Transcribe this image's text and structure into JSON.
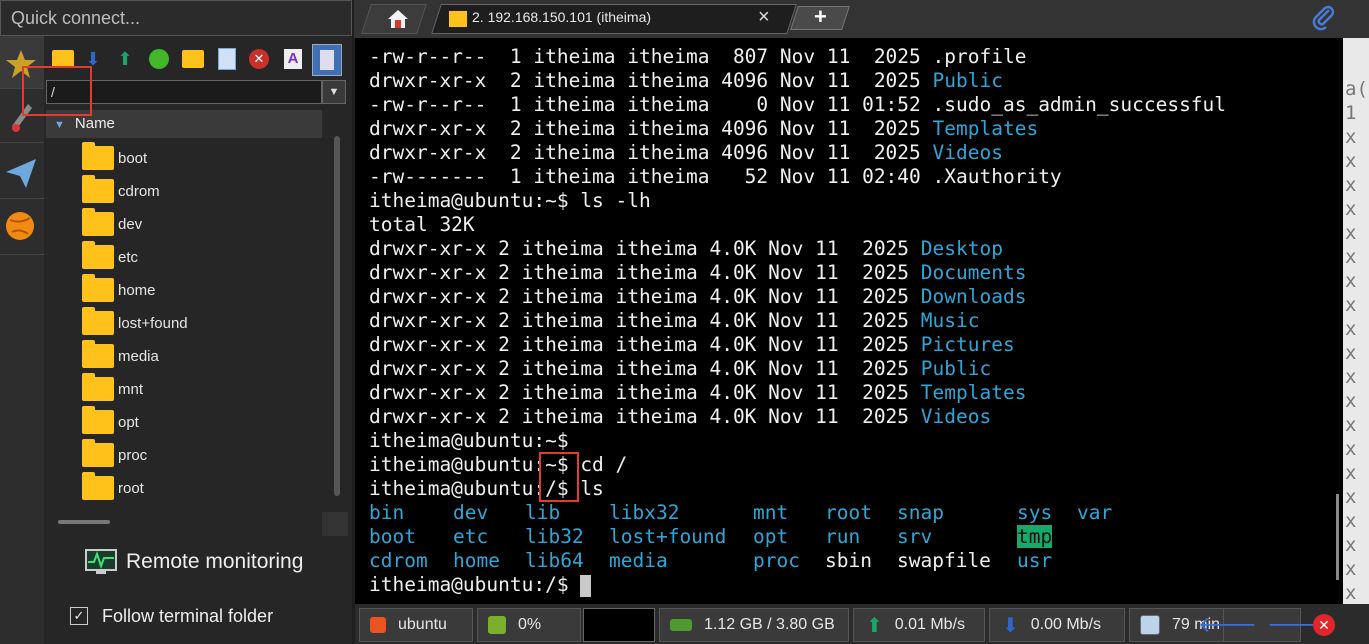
{
  "quick_connect": {
    "placeholder": "Quick connect..."
  },
  "tabs": [
    {
      "label": "2. 192.168.150.101 (itheima)",
      "close": "×"
    }
  ],
  "new_tab_label": "+",
  "sftp": {
    "path": "/",
    "column_name": "Name",
    "folders": [
      "boot",
      "cdrom",
      "dev",
      "etc",
      "home",
      "lost+found",
      "media",
      "mnt",
      "opt",
      "proc",
      "root"
    ],
    "remote_monitoring": "Remote monitoring",
    "follow_terminal": "Follow terminal folder"
  },
  "terminal": {
    "lines": [
      {
        "text": "-rw-r--r--  1 itheima itheima  807 Nov 11  2025 ",
        "name": ".profile",
        "blue": false
      },
      {
        "text": "drwxr-xr-x  2 itheima itheima 4096 Nov 11  2025 ",
        "name": "Public",
        "blue": true
      },
      {
        "text": "-rw-r--r--  1 itheima itheima    0 Nov 11 01:52 ",
        "name": ".sudo_as_admin_successful",
        "blue": false
      },
      {
        "text": "drwxr-xr-x  2 itheima itheima 4096 Nov 11  2025 ",
        "name": "Templates",
        "blue": true
      },
      {
        "text": "drwxr-xr-x  2 itheima itheima 4096 Nov 11  2025 ",
        "name": "Videos",
        "blue": true
      },
      {
        "text": "-rw-------  1 itheima itheima   52 Nov 11 02:40 ",
        "name": ".Xauthority",
        "blue": false
      },
      {
        "text": "itheima@ubuntu:~$ ls -lh",
        "name": "",
        "blue": false
      },
      {
        "text": "total 32K",
        "name": "",
        "blue": false
      },
      {
        "text": "drwxr-xr-x 2 itheima itheima 4.0K Nov 11  2025 ",
        "name": "Desktop",
        "blue": true
      },
      {
        "text": "drwxr-xr-x 2 itheima itheima 4.0K Nov 11  2025 ",
        "name": "Documents",
        "blue": true
      },
      {
        "text": "drwxr-xr-x 2 itheima itheima 4.0K Nov 11  2025 ",
        "name": "Downloads",
        "blue": true
      },
      {
        "text": "drwxr-xr-x 2 itheima itheima 4.0K Nov 11  2025 ",
        "name": "Music",
        "blue": true
      },
      {
        "text": "drwxr-xr-x 2 itheima itheima 4.0K Nov 11  2025 ",
        "name": "Pictures",
        "blue": true
      },
      {
        "text": "drwxr-xr-x 2 itheima itheima 4.0K Nov 11  2025 ",
        "name": "Public",
        "blue": true
      },
      {
        "text": "drwxr-xr-x 2 itheima itheima 4.0K Nov 11  2025 ",
        "name": "Templates",
        "blue": true
      },
      {
        "text": "drwxr-xr-x 2 itheima itheima 4.0K Nov 11  2025 ",
        "name": "Videos",
        "blue": true
      },
      {
        "text": "itheima@ubuntu:~$",
        "name": "",
        "blue": false
      },
      {
        "text": "itheima@ubuntu:~$ cd /",
        "name": "",
        "blue": false
      },
      {
        "text": "itheima@ubuntu:/$ ls",
        "name": "",
        "blue": false
      }
    ],
    "ls_rows": [
      [
        {
          "t": "bin",
          "c": "blue"
        },
        {
          "t": "dev",
          "c": "blue"
        },
        {
          "t": "lib",
          "c": "blue"
        },
        {
          "t": "libx32",
          "c": "blue"
        },
        {
          "t": "mnt",
          "c": "blue"
        },
        {
          "t": "root",
          "c": "blue"
        },
        {
          "t": "snap",
          "c": "blue"
        },
        {
          "t": "sys",
          "c": "blue"
        },
        {
          "t": "var",
          "c": "blue"
        }
      ],
      [
        {
          "t": "boot",
          "c": "blue"
        },
        {
          "t": "etc",
          "c": "blue"
        },
        {
          "t": "lib32",
          "c": "blue"
        },
        {
          "t": "lost+found",
          "c": "blue"
        },
        {
          "t": "opt",
          "c": "blue"
        },
        {
          "t": "run",
          "c": "blue"
        },
        {
          "t": "srv",
          "c": "blue"
        },
        {
          "t": "tmp",
          "c": "hl"
        }
      ],
      [
        {
          "t": "cdrom",
          "c": "blue"
        },
        {
          "t": "home",
          "c": "blue"
        },
        {
          "t": "lib64",
          "c": "blue"
        },
        {
          "t": "media",
          "c": "blue"
        },
        {
          "t": "proc",
          "c": "blue"
        },
        {
          "t": "sbin",
          "c": "white"
        },
        {
          "t": "swapfile",
          "c": "white"
        },
        {
          "t": "usr",
          "c": "blue"
        }
      ]
    ],
    "prompt": "itheima@ubuntu:/$ "
  },
  "status": {
    "host": "ubuntu",
    "cpu": "0%",
    "memory": "1.12 GB / 3.80 GB",
    "upload": "0.01 Mb/s",
    "download": "0.00 Mb/s",
    "uptime": "79 min"
  },
  "right_panel_chars": [
    "a(",
    "1",
    "x",
    "x",
    "x",
    "x",
    "x",
    "x",
    "x",
    "x",
    "x",
    "x",
    "x",
    "x",
    "x",
    "x",
    "x",
    "x",
    "x",
    "x",
    "x",
    "x",
    "x"
  ],
  "colors": {
    "accent_blue": "#2ea6d9",
    "highlight_green": "#17a86a",
    "annotation_red": "#e53b2c",
    "folder_yellow": "#ffc21a"
  }
}
